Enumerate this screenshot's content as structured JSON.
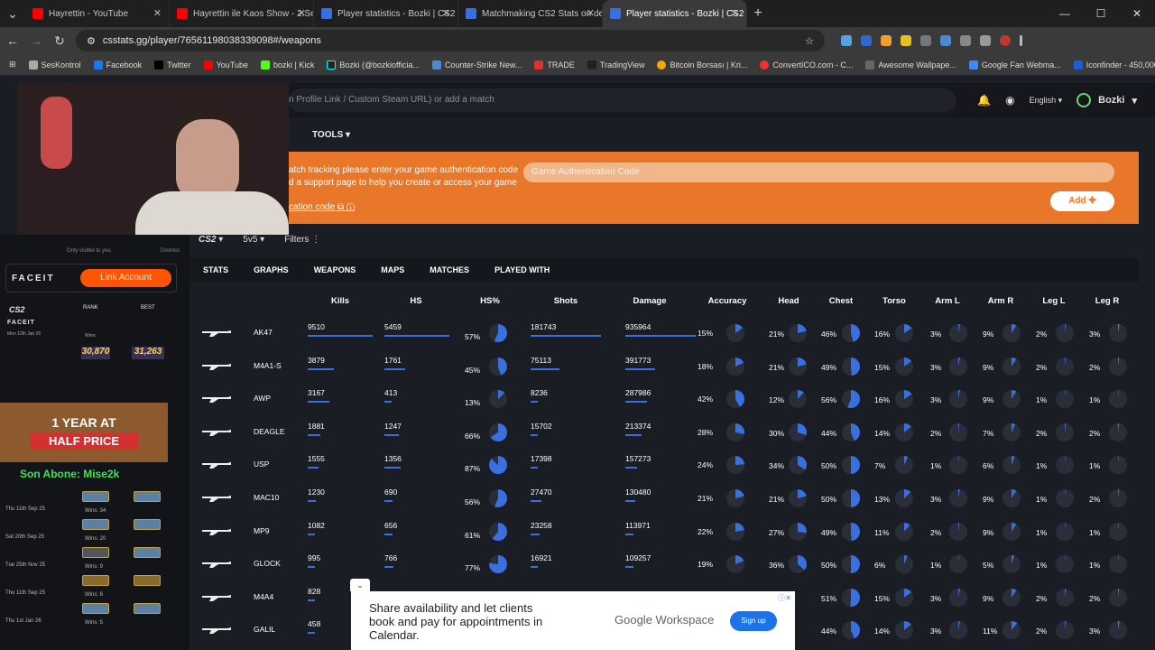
{
  "browser": {
    "tabs": [
      {
        "title": "Hayrettin - YouTube",
        "color": "#ff0000"
      },
      {
        "title": "Hayrettin ile Kaos Show - 2.Se",
        "color": "#ff0000"
      },
      {
        "title": "Player statistics - Bozki | CS2 St",
        "color": "#3a6fe0"
      },
      {
        "title": "Matchmaking CS2 Stats on de_",
        "color": "#3a6fe0"
      },
      {
        "title": "Player statistics - Bozki | CS2 St",
        "color": "#3a6fe0",
        "active": true
      }
    ],
    "url": "csstats.gg/player/76561198038339098#/weapons",
    "bookmarks": [
      "SesKontrol",
      "Facebook",
      "Twitter",
      "YouTube",
      "bozki | Kick",
      "Bozki (@bozkiofficia...",
      "Counter-Strike New...",
      "TRADE",
      "TradingView",
      "Bitcoin Borsası | Kri...",
      "ConvertICO.com - C...",
      "Awesome Wallpape...",
      "Google Fan Webma...",
      "Iconfinder - 450,000..."
    ]
  },
  "site": {
    "search_placeholder": "n Profile Link / Custom Steam URL) or add a match",
    "language": "English",
    "username": "Bozki",
    "tools_label": "TOOLS",
    "banner_line1": "atch tracking please enter your game authentication code",
    "banner_line2": "d a support page to help you create or access your game",
    "banner_link": "cation code",
    "auth_placeholder": "Game Authentication Code",
    "add_label": "Add",
    "game_filter": "CS2",
    "mode_filter": "5v5",
    "filters_label": "Filters",
    "nav_tabs": [
      "STATS",
      "GRAPHS",
      "WEAPONS",
      "MAPS",
      "MATCHES",
      "PLAYED WITH"
    ]
  },
  "table": {
    "headers": [
      "Kills",
      "HS",
      "HS%",
      "Shots",
      "Damage",
      "Accuracy",
      "Head",
      "Chest",
      "Torso",
      "Arm L",
      "Arm R",
      "Leg L",
      "Leg R"
    ],
    "rows": [
      {
        "weapon": "AK47",
        "kills": "9510",
        "hs": "5459",
        "hs_pct": "57%",
        "shots": "181743",
        "damage": "935964",
        "acc": "15%",
        "head": "21%",
        "chest": "46%",
        "torso": "16%",
        "arml": "3%",
        "armr": "9%",
        "legl": "2%",
        "legr": "3%"
      },
      {
        "weapon": "M4A1-S",
        "kills": "3879",
        "hs": "1761",
        "hs_pct": "45%",
        "shots": "75113",
        "damage": "391773",
        "acc": "18%",
        "head": "21%",
        "chest": "49%",
        "torso": "15%",
        "arml": "3%",
        "armr": "9%",
        "legl": "2%",
        "legr": "2%"
      },
      {
        "weapon": "AWP",
        "kills": "3167",
        "hs": "413",
        "hs_pct": "13%",
        "shots": "8236",
        "damage": "287986",
        "acc": "42%",
        "head": "12%",
        "chest": "56%",
        "torso": "16%",
        "arml": "3%",
        "armr": "9%",
        "legl": "1%",
        "legr": "1%"
      },
      {
        "weapon": "DEAGLE",
        "kills": "1881",
        "hs": "1247",
        "hs_pct": "66%",
        "shots": "15702",
        "damage": "213374",
        "acc": "28%",
        "head": "30%",
        "chest": "44%",
        "torso": "14%",
        "arml": "2%",
        "armr": "7%",
        "legl": "2%",
        "legr": "2%"
      },
      {
        "weapon": "USP",
        "kills": "1555",
        "hs": "1356",
        "hs_pct": "87%",
        "shots": "17398",
        "damage": "157273",
        "acc": "24%",
        "head": "34%",
        "chest": "50%",
        "torso": "7%",
        "arml": "1%",
        "armr": "6%",
        "legl": "1%",
        "legr": "1%"
      },
      {
        "weapon": "MAC10",
        "kills": "1230",
        "hs": "690",
        "hs_pct": "56%",
        "shots": "27470",
        "damage": "130480",
        "acc": "21%",
        "head": "21%",
        "chest": "50%",
        "torso": "13%",
        "arml": "3%",
        "armr": "9%",
        "legl": "1%",
        "legr": "2%"
      },
      {
        "weapon": "MP9",
        "kills": "1082",
        "hs": "656",
        "hs_pct": "61%",
        "shots": "23258",
        "damage": "113971",
        "acc": "22%",
        "head": "27%",
        "chest": "49%",
        "torso": "11%",
        "arml": "2%",
        "armr": "9%",
        "legl": "1%",
        "legr": "1%"
      },
      {
        "weapon": "GLOCK",
        "kills": "995",
        "hs": "766",
        "hs_pct": "77%",
        "shots": "16921",
        "damage": "109257",
        "acc": "19%",
        "head": "36%",
        "chest": "50%",
        "torso": "6%",
        "arml": "1%",
        "armr": "5%",
        "legl": "1%",
        "legr": "1%"
      },
      {
        "weapon": "M4A4",
        "kills": "828",
        "hs": "",
        "hs_pct": "",
        "shots": "",
        "damage": "",
        "acc": "",
        "head": "",
        "chest": "51%",
        "torso": "15%",
        "arml": "3%",
        "armr": "9%",
        "legl": "2%",
        "legr": "2%"
      },
      {
        "weapon": "GALIL",
        "kills": "458",
        "hs": "",
        "hs_pct": "",
        "shots": "",
        "damage": "",
        "acc": "",
        "head": "",
        "chest": "44%",
        "torso": "14%",
        "arml": "3%",
        "armr": "11%",
        "legl": "2%",
        "legr": "3%"
      }
    ]
  },
  "overlay": {
    "visible_note": "Only visible to you",
    "dismiss": "Dismiss",
    "faceit_label": "FACEIT",
    "link_account": "Link Account",
    "cs2_label": "CS2",
    "rank_label": "RANK",
    "best_label": "BEST",
    "promo_line1": "1 YEAR AT",
    "promo_line2": "HALF PRICE",
    "abone": "Son Abone: Mise2k",
    "premier_rating": "30,870",
    "premier_best": "31,263",
    "history": [
      {
        "date": "Mon 12th Jan 26",
        "wins": "Wins:"
      },
      {
        "date": "Thu 11th Sep 25",
        "wins": "Wins: 34"
      },
      {
        "date": "Sat 20th Sep 25",
        "wins": "Wins: 20"
      },
      {
        "date": "Tue 25th Nov 25",
        "wins": "Wins: 9"
      },
      {
        "date": "Thu 11th Sep 25",
        "wins": "Wins: 6"
      },
      {
        "date": "Thu 1st Jan 26",
        "wins": "Wins: 5"
      }
    ]
  },
  "ad": {
    "text": "Share availability and let clients book and pay for appointments in Calendar.",
    "brand": "Google Workspace",
    "cta": "Sign up"
  }
}
